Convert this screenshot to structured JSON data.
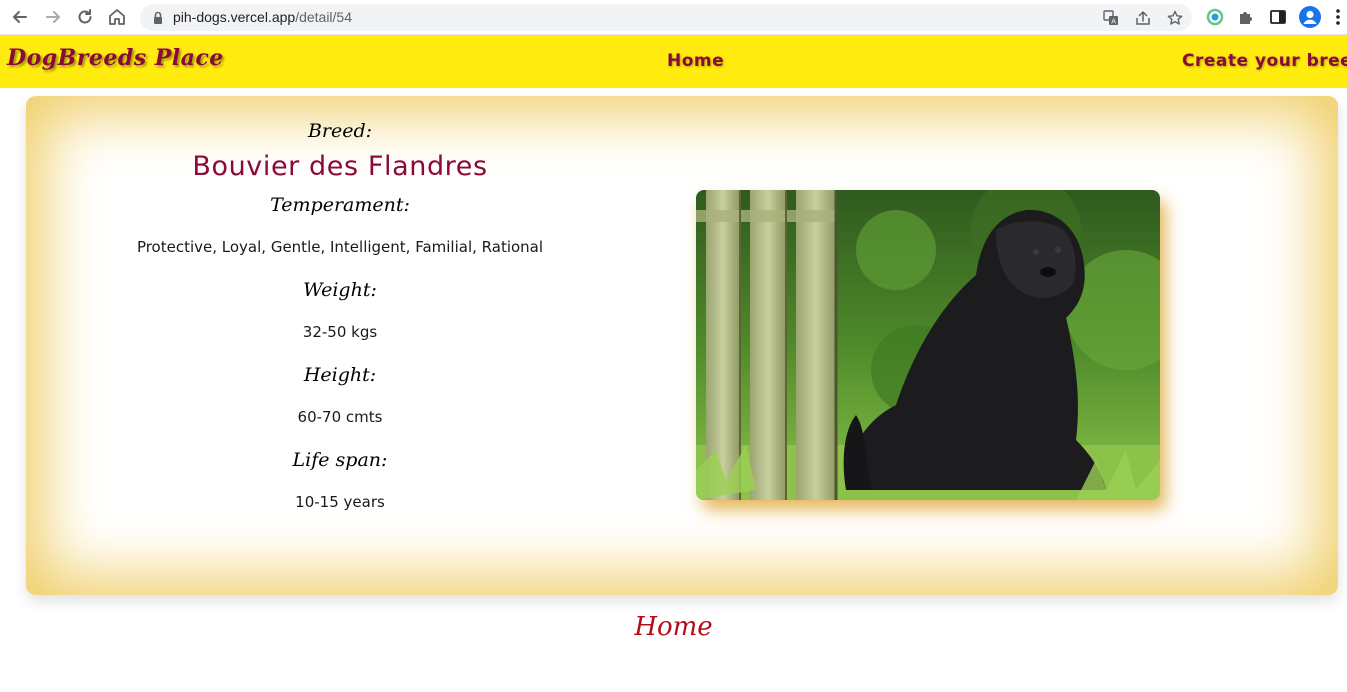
{
  "browser": {
    "url_host": "pih-dogs.vercel.app",
    "url_path": "/detail/54",
    "icons": [
      "back-icon",
      "forward-icon",
      "reload-icon",
      "home-icon",
      "lock-icon",
      "translate-icon",
      "share-icon",
      "star-icon",
      "extension-icon",
      "puzzle-icon",
      "side-panel-icon",
      "profile-icon",
      "menu-icon"
    ]
  },
  "navbar": {
    "brand": "DogBreeds Place",
    "home_label": "Home",
    "create_label": "Create your breed"
  },
  "detail": {
    "breed_label": "Breed:",
    "breed_name": "Bouvier des Flandres",
    "temperament_label": "Temperament:",
    "temperament": "Protective, Loyal, Gentle, Intelligent, Familial, Rational",
    "weight_label": "Weight:",
    "weight": "32-50 kgs",
    "height_label": "Height:",
    "height": "60-70 cmts",
    "lifespan_label": "Life span:",
    "lifespan": "10-15 years"
  },
  "footer": {
    "home_label": "Home"
  },
  "colors": {
    "navbar_bg": "#ffec0e",
    "accent": "#8b0a3a",
    "footer_link": "#b30c1a",
    "card_glow": "#f0cf6a"
  }
}
